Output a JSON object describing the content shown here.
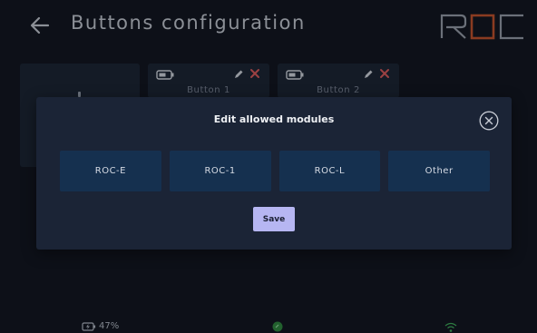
{
  "header": {
    "title": "Buttons configuration",
    "logo_text": "ROC"
  },
  "cards": [
    {
      "label": "Button 1"
    },
    {
      "label": "Button 2"
    }
  ],
  "status_bar": {
    "battery_text": "47%"
  },
  "modal": {
    "title": "Edit allowed modules",
    "modules": [
      "ROC-E",
      "ROC-1",
      "ROC-L",
      "Other"
    ],
    "save_label": "Save"
  },
  "colors": {
    "background": "#0f131c",
    "card": "#1a2232",
    "modal": "#1b2436",
    "module_button": "#15304f",
    "save_button": "#b6b6f2",
    "logo_accent": "#c8522a",
    "delete_icon": "#e05b5b",
    "status_green": "#2f8a3d"
  },
  "icons": {
    "back": "arrow-left-icon",
    "battery": "battery-icon",
    "edit": "pencil-icon",
    "delete": "close-icon",
    "modal_close": "circle-close-icon",
    "wifi": "wifi-icon"
  }
}
